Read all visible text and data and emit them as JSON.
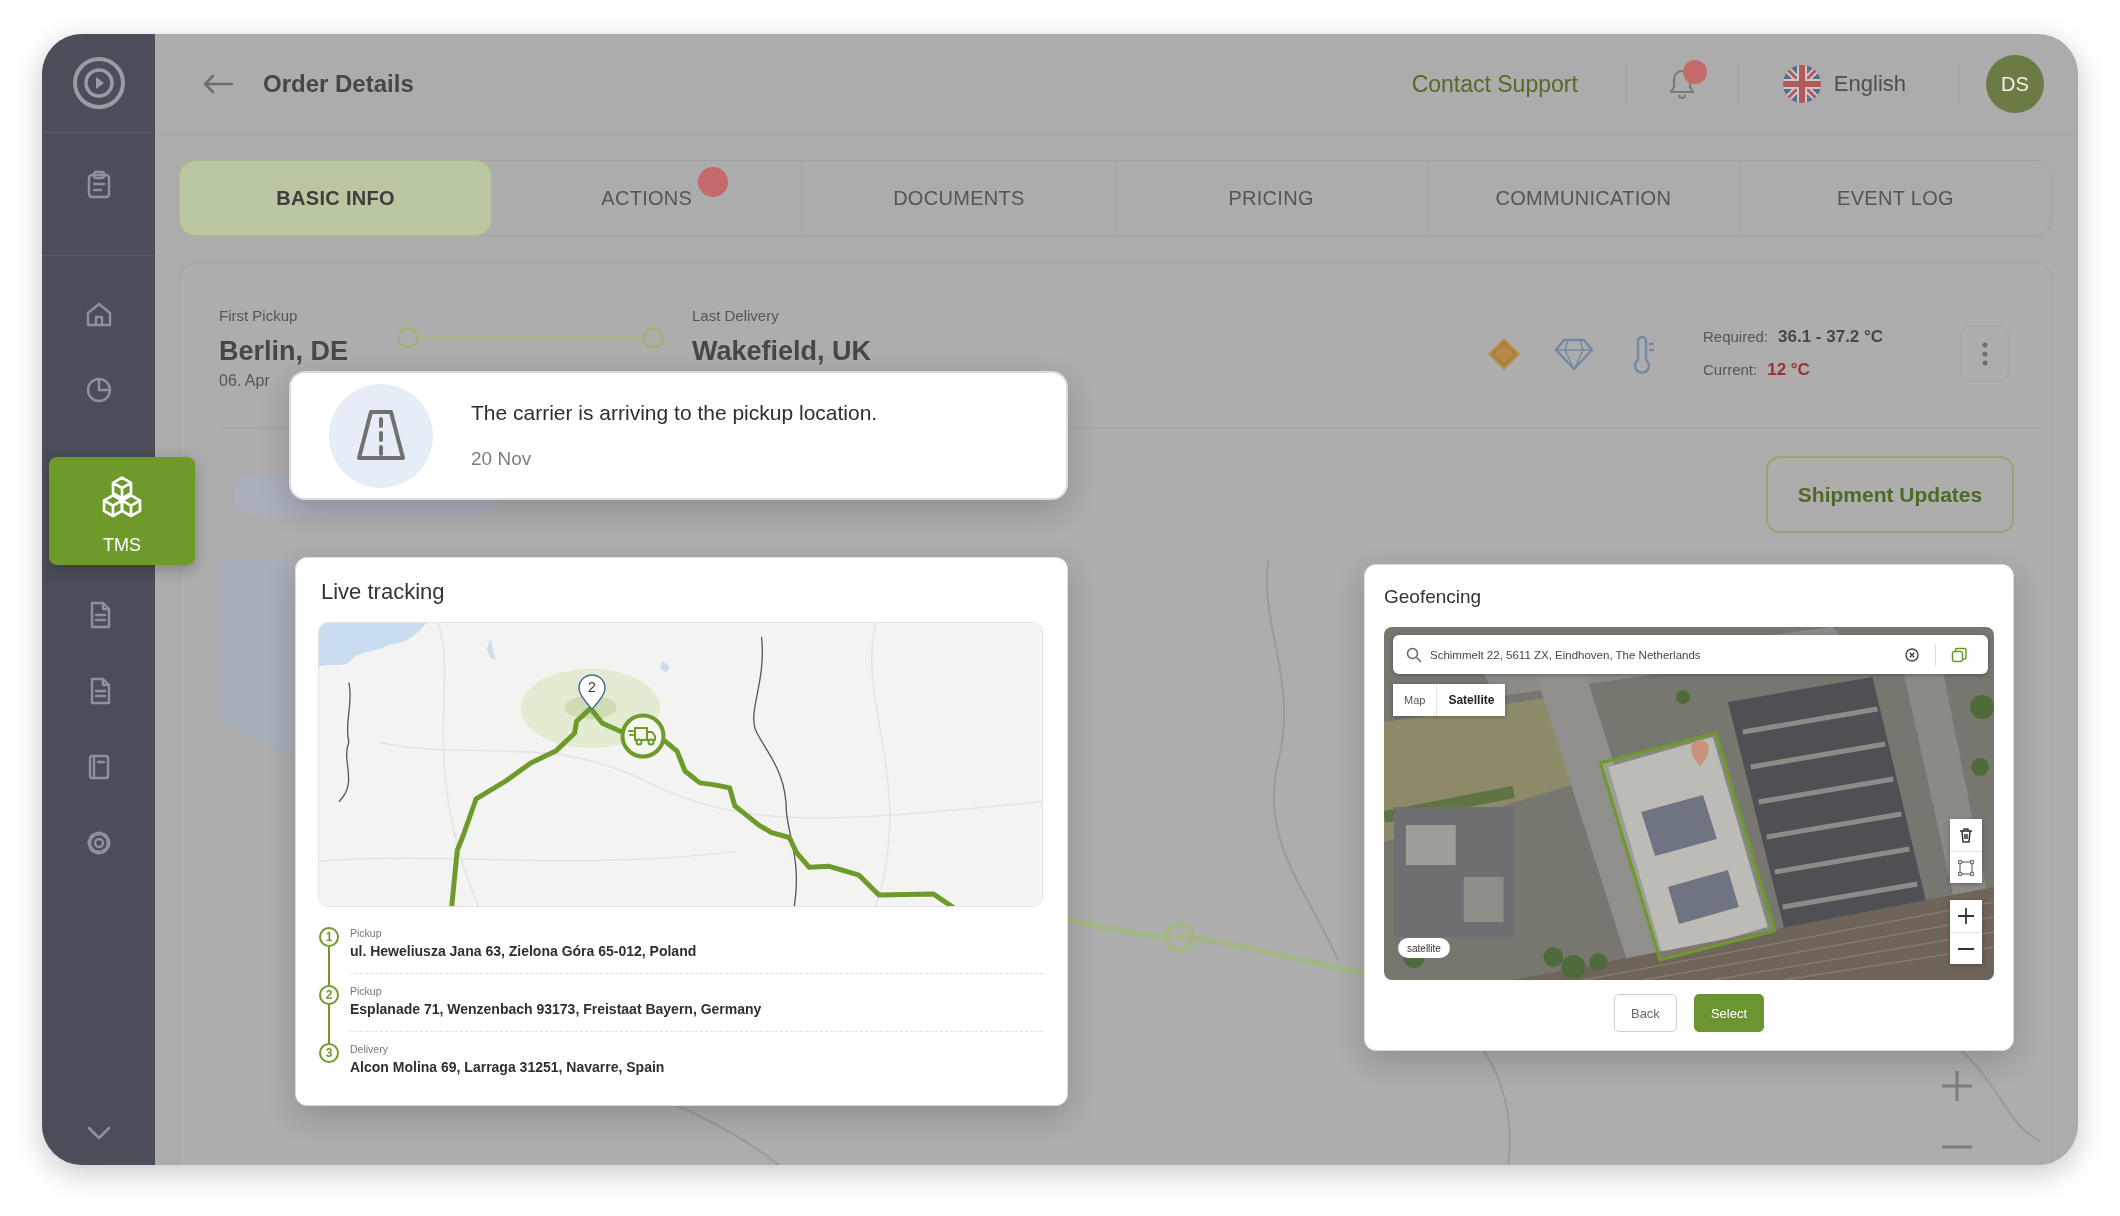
{
  "sidebar": {
    "items": [
      {
        "selected": false
      },
      {
        "selected": false
      },
      {
        "selected": false
      },
      {
        "label": "TMS",
        "selected": true
      },
      {
        "selected": false
      },
      {
        "selected": false
      },
      {
        "selected": false
      },
      {
        "selected": false
      }
    ]
  },
  "header": {
    "title": "Order Details",
    "contact_link": "Contact Support",
    "notifications": {
      "unread": true
    },
    "language": "English",
    "avatar_initials": "DS"
  },
  "tabs": [
    {
      "label": "BASIC INFO",
      "selected": true,
      "badge": false
    },
    {
      "label": "ACTIONS",
      "selected": false,
      "badge": true
    },
    {
      "label": "DOCUMENTS",
      "selected": false,
      "badge": false
    },
    {
      "label": "PRICING",
      "selected": false,
      "badge": false
    },
    {
      "label": "COMMUNICATION",
      "selected": false,
      "badge": false
    },
    {
      "label": "EVENT LOG",
      "selected": false,
      "badge": false
    }
  ],
  "route_summary": {
    "first_pickup": {
      "label": "First Pickup",
      "city": "Berlin, DE",
      "date": "06. Apr"
    },
    "last_delivery": {
      "label": "Last Delivery",
      "city": "Wakefield, UK"
    }
  },
  "conditions": {
    "required_label": "Required:",
    "required_value": "36.1 - 37.2 °C",
    "current_label": "Current:",
    "current_value": "12 °C",
    "current_out_of_range": true
  },
  "shipment_updates_button": "Shipment Updates",
  "notification_toast": {
    "message": "The carrier is arriving to the pickup location.",
    "date": "20 Nov"
  },
  "live_tracking": {
    "title": "Live tracking",
    "map": {
      "marker_label": "2"
    },
    "stops": [
      {
        "number": "1",
        "type": "Pickup",
        "address": "ul. Heweliusza Jana 63, Zielona Góra 65-012, Poland"
      },
      {
        "number": "2",
        "type": "Pickup",
        "address": "Esplanade 71, Wenzenbach 93173, Freistaat Bayern, Germany"
      },
      {
        "number": "3",
        "type": "Delivery",
        "address": "Alcon Molina 69, Larraga 31251, Navarre, Spain"
      }
    ]
  },
  "geofencing": {
    "title": "Geofencing",
    "search": {
      "value": "Schimmelt 22, 5611 ZX, Eindhoven, The Netherlands"
    },
    "map_types": [
      {
        "label": "Map",
        "selected": false
      },
      {
        "label": "Satellite",
        "selected": true
      }
    ],
    "layer_badge": "satellite",
    "buttons": [
      {
        "label": "Back",
        "kind": "secondary"
      },
      {
        "label": "Select",
        "kind": "primary"
      }
    ]
  }
}
